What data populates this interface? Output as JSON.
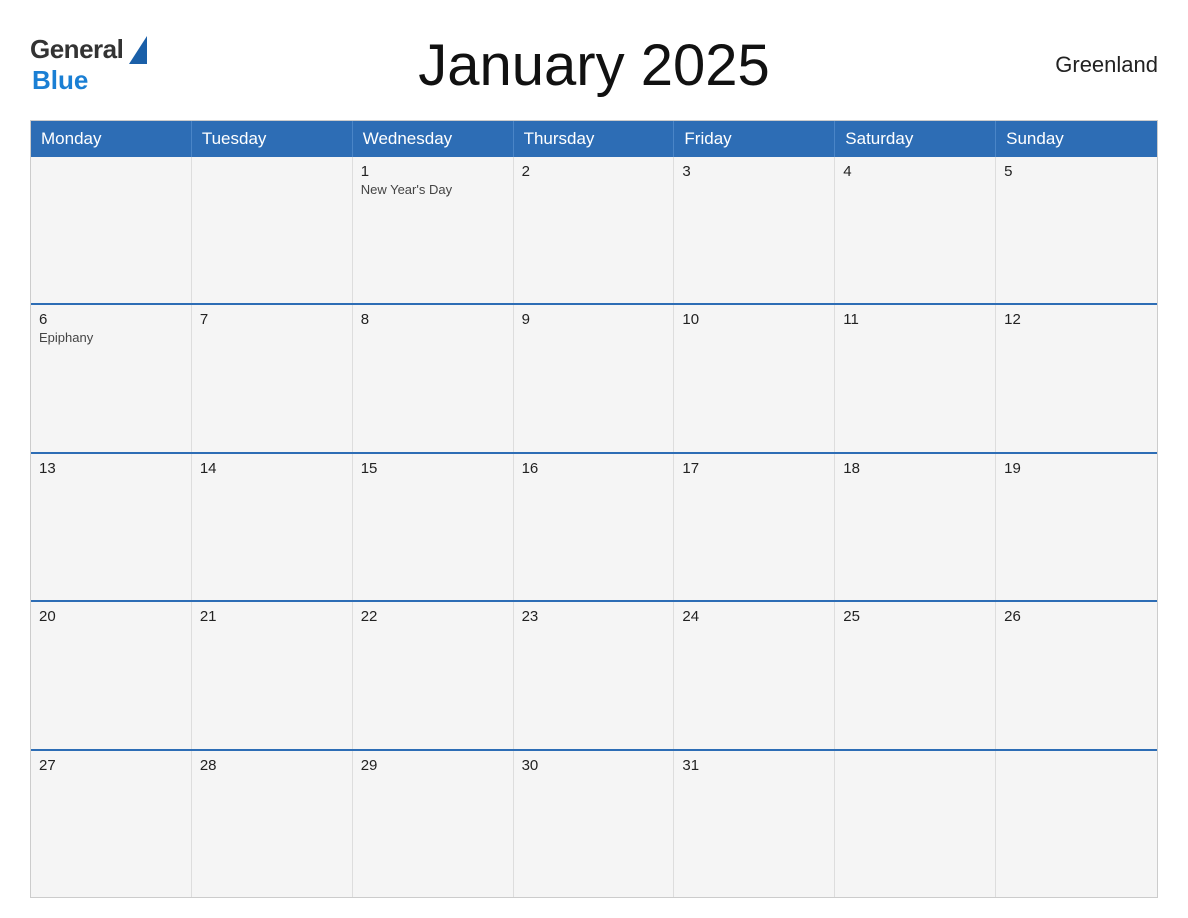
{
  "header": {
    "logo_general": "General",
    "logo_blue": "Blue",
    "title": "January 2025",
    "region": "Greenland"
  },
  "days_of_week": [
    "Monday",
    "Tuesday",
    "Wednesday",
    "Thursday",
    "Friday",
    "Saturday",
    "Sunday"
  ],
  "weeks": [
    [
      {
        "num": "",
        "holiday": ""
      },
      {
        "num": "",
        "holiday": ""
      },
      {
        "num": "1",
        "holiday": "New Year's Day"
      },
      {
        "num": "2",
        "holiday": ""
      },
      {
        "num": "3",
        "holiday": ""
      },
      {
        "num": "4",
        "holiday": ""
      },
      {
        "num": "5",
        "holiday": ""
      }
    ],
    [
      {
        "num": "6",
        "holiday": "Epiphany"
      },
      {
        "num": "7",
        "holiday": ""
      },
      {
        "num": "8",
        "holiday": ""
      },
      {
        "num": "9",
        "holiday": ""
      },
      {
        "num": "10",
        "holiday": ""
      },
      {
        "num": "11",
        "holiday": ""
      },
      {
        "num": "12",
        "holiday": ""
      }
    ],
    [
      {
        "num": "13",
        "holiday": ""
      },
      {
        "num": "14",
        "holiday": ""
      },
      {
        "num": "15",
        "holiday": ""
      },
      {
        "num": "16",
        "holiday": ""
      },
      {
        "num": "17",
        "holiday": ""
      },
      {
        "num": "18",
        "holiday": ""
      },
      {
        "num": "19",
        "holiday": ""
      }
    ],
    [
      {
        "num": "20",
        "holiday": ""
      },
      {
        "num": "21",
        "holiday": ""
      },
      {
        "num": "22",
        "holiday": ""
      },
      {
        "num": "23",
        "holiday": ""
      },
      {
        "num": "24",
        "holiday": ""
      },
      {
        "num": "25",
        "holiday": ""
      },
      {
        "num": "26",
        "holiday": ""
      }
    ],
    [
      {
        "num": "27",
        "holiday": ""
      },
      {
        "num": "28",
        "holiday": ""
      },
      {
        "num": "29",
        "holiday": ""
      },
      {
        "num": "30",
        "holiday": ""
      },
      {
        "num": "31",
        "holiday": ""
      },
      {
        "num": "",
        "holiday": ""
      },
      {
        "num": "",
        "holiday": ""
      }
    ]
  ]
}
